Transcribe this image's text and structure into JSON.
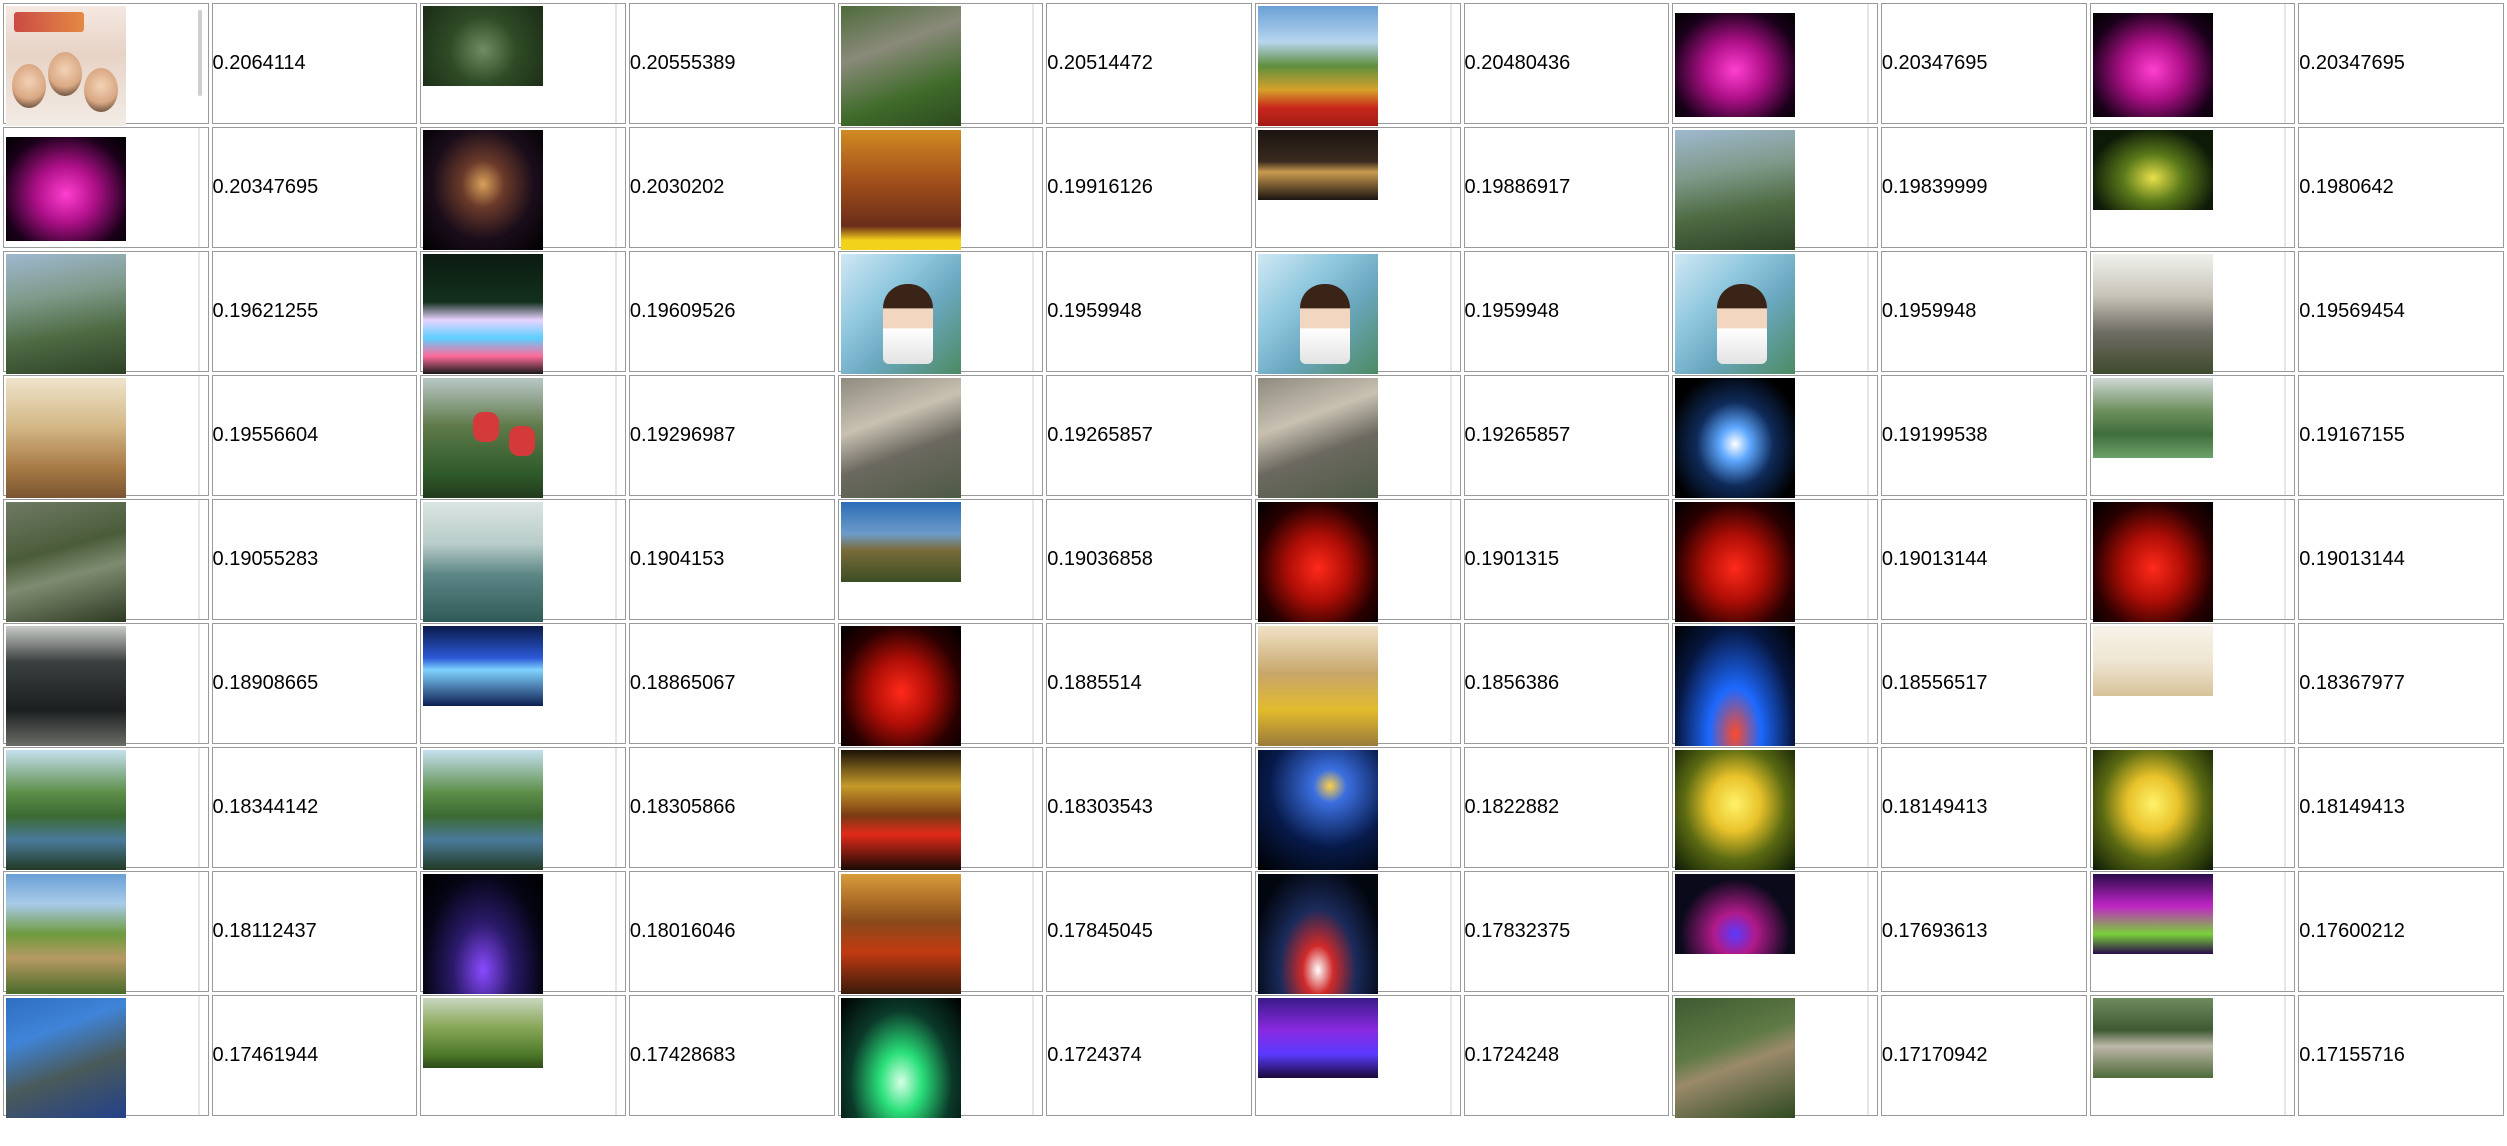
{
  "rows": [
    {
      "cells": [
        {
          "img": "poster-three-men",
          "score": "0.2064114"
        },
        {
          "img": "garden-pond",
          "score": "0.20555389"
        },
        {
          "img": "mountain-cliff",
          "score": "0.20514472"
        },
        {
          "img": "flower-field",
          "score": "0.20480436"
        },
        {
          "img": "magenta-stage",
          "score": "0.20347695"
        },
        {
          "img": "magenta-stage",
          "score": "0.20347695"
        }
      ]
    },
    {
      "cells": [
        {
          "img": "magenta-stage",
          "score": "0.20347695"
        },
        {
          "img": "buddha-night",
          "score": "0.2030202"
        },
        {
          "img": "temple-hall-poster",
          "score": "0.19916126"
        },
        {
          "img": "banner-dark",
          "score": "0.19886917"
        },
        {
          "img": "mountain-ridge",
          "score": "0.19839999"
        },
        {
          "img": "yellow-show",
          "score": "0.1980642"
        }
      ]
    },
    {
      "cells": [
        {
          "img": "mountain-ridge",
          "score": "0.19621255"
        },
        {
          "img": "rainbow-stairs-night",
          "score": "0.19609526"
        },
        {
          "img": "anime-dragon-girl",
          "score": "0.1959948"
        },
        {
          "img": "anime-dragon-girl",
          "score": "0.1959948"
        },
        {
          "img": "anime-dragon-girl",
          "score": "0.1959948"
        },
        {
          "img": "stone-gate",
          "score": "0.19569454"
        }
      ]
    },
    {
      "cells": [
        {
          "img": "dining-room",
          "score": "0.19556604"
        },
        {
          "img": "cable-car",
          "score": "0.19296987"
        },
        {
          "img": "rock-peak",
          "score": "0.19265857"
        },
        {
          "img": "rock-peak",
          "score": "0.19265857"
        },
        {
          "img": "anime-girl-stage",
          "score": "0.19199538"
        },
        {
          "img": "lotus-pond-pavilion",
          "score": "0.19167155"
        }
      ]
    },
    {
      "cells": [
        {
          "img": "forest-waterfall",
          "score": "0.19055283"
        },
        {
          "img": "pagoda-lake",
          "score": "0.1904153"
        },
        {
          "img": "great-wall-sky",
          "score": "0.19036858"
        },
        {
          "img": "red-lanterns",
          "score": "0.1901315"
        },
        {
          "img": "red-lanterns",
          "score": "0.19013144"
        },
        {
          "img": "red-lanterns",
          "score": "0.19013144"
        }
      ]
    },
    {
      "cells": [
        {
          "img": "tour-buses",
          "score": "0.18908665"
        },
        {
          "img": "blue-night-river",
          "score": "0.18865067"
        },
        {
          "img": "red-lanterns",
          "score": "0.1885514"
        },
        {
          "img": "yellow-carpet-hall",
          "score": "0.1856386"
        },
        {
          "img": "blue-laser-stage",
          "score": "0.18556517"
        },
        {
          "img": "hotel-room",
          "score": "0.18367977"
        }
      ]
    },
    {
      "cells": [
        {
          "img": "willow-pond",
          "score": "0.18344142"
        },
        {
          "img": "willow-pond",
          "score": "0.18305866"
        },
        {
          "img": "pavilion-night",
          "score": "0.18303543"
        },
        {
          "img": "blue-dancers",
          "score": "0.1822882"
        },
        {
          "img": "golden-tree",
          "score": "0.18149413"
        },
        {
          "img": "golden-tree",
          "score": "0.18149413"
        }
      ]
    },
    {
      "cells": [
        {
          "img": "great-wall-green",
          "score": "0.18112437"
        },
        {
          "img": "purple-poster",
          "score": "0.18016046"
        },
        {
          "img": "palace-interior",
          "score": "0.17845045"
        },
        {
          "img": "red-dancers-stage",
          "score": "0.17832375"
        },
        {
          "img": "purple-show",
          "score": "0.17693613"
        },
        {
          "img": "purple-field-show",
          "score": "0.17600212"
        }
      ]
    },
    {
      "cells": [
        {
          "img": "sea-cliff",
          "score": "0.17461944"
        },
        {
          "img": "tea-leaves",
          "score": "0.17428683"
        },
        {
          "img": "lotus-dancer",
          "score": "0.1724374"
        },
        {
          "img": "purple-hillside",
          "score": "0.1724248"
        },
        {
          "img": "aerial-temple",
          "score": "0.17170942"
        },
        {
          "img": "stone-bridge",
          "score": "0.17155716"
        }
      ]
    }
  ]
}
